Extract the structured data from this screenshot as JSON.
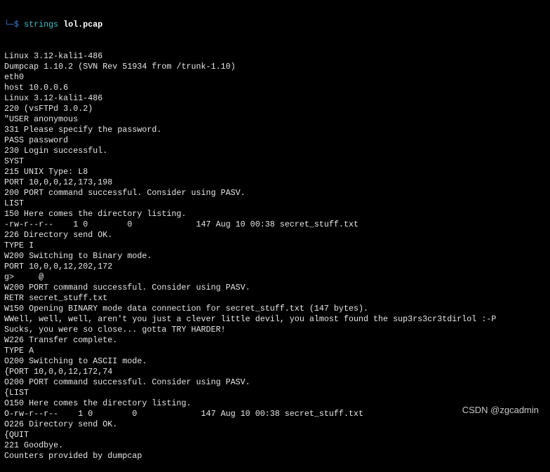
{
  "prompt": {
    "corner": "└─",
    "symbol": "$ ",
    "command": "strings",
    "argument": "lol.pcap"
  },
  "output_lines": [
    "Linux 3.12-kali1-486",
    "Dumpcap 1.10.2 (SVN Rev 51934 from /trunk-1.10)",
    "eth0",
    "host 10.0.0.6",
    "Linux 3.12-kali1-486",
    "220 (vsFTPd 3.0.2)",
    "\"USER anonymous",
    "331 Please specify the password.",
    "PASS password",
    "230 Login successful.",
    "SYST",
    "215 UNIX Type: L8",
    "PORT 10,0,0,12,173,198",
    "200 PORT command successful. Consider using PASV.",
    "LIST",
    "150 Here comes the directory listing.",
    "-rw-r--r--    1 0        0             147 Aug 10 00:38 secret_stuff.txt",
    "226 Directory send OK.",
    "TYPE I",
    "W200 Switching to Binary mode.",
    "PORT 10,0,0,12,202,172",
    "g>     @",
    "W200 PORT command successful. Consider using PASV.",
    "RETR secret_stuff.txt",
    "W150 Opening BINARY mode data connection for secret_stuff.txt (147 bytes).",
    "WWell, well, well, aren't you just a clever little devil, you almost found the sup3rs3cr3tdirlol :-P",
    "Sucks, you were so close... gotta TRY HARDER!",
    "W226 Transfer complete.",
    "TYPE A",
    "O200 Switching to ASCII mode.",
    "{PORT 10,0,0,12,172,74",
    "O200 PORT command successful. Consider using PASV.",
    "{LIST",
    "O150 Here comes the directory listing.",
    "O-rw-r--r--    1 0        0             147 Aug 10 00:38 secret_stuff.txt",
    "O226 Directory send OK.",
    "{QUIT",
    "221 Goodbye.",
    "Counters provided by dumpcap"
  ],
  "watermark": "CSDN @zgcadmin",
  "colors": {
    "background": "#000000",
    "text": "#e6e6e6",
    "prompt_corner": "#3b7bd6",
    "command": "#3fc1c9"
  }
}
